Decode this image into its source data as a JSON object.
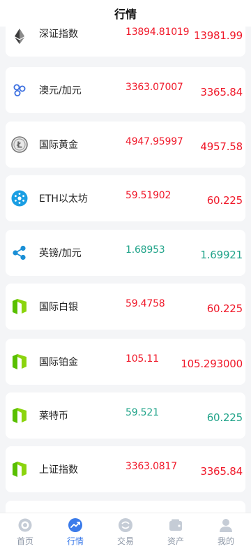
{
  "header": {
    "title": "行情"
  },
  "colors": {
    "up": "#f0192a",
    "down": "#22a48a",
    "active_tab": "#3b7bea",
    "inactive_tab": "#8f99a8"
  },
  "markets": [
    {
      "name": "深证指数",
      "price": "13894.81019",
      "change": "13981.99",
      "trend": "up",
      "icon": "ethereum-diamond-icon"
    },
    {
      "name": "澳元/加元",
      "price": "3363.07007",
      "change": "3365.84",
      "trend": "up",
      "icon": "chain-link-icon"
    },
    {
      "name": "国际黄金",
      "price": "4947.95997",
      "change": "4957.58",
      "trend": "up",
      "icon": "litecoin-icon"
    },
    {
      "name": "ETH以太坊",
      "price": "59.51902",
      "change": "60.225",
      "trend": "up",
      "icon": "cardano-icon"
    },
    {
      "name": "英镑/加元",
      "price": "1.68953",
      "change": "1.69921",
      "trend": "down",
      "icon": "ripple-icon"
    },
    {
      "name": "国际白银",
      "price": "59.4758",
      "change": "60.225",
      "trend": "up",
      "icon": "neo-icon"
    },
    {
      "name": "国际铂金",
      "price": "105.11",
      "change": "105.293000",
      "trend": "up",
      "icon": "neo-icon"
    },
    {
      "name": "莱特币",
      "price": "59.521",
      "change": "60.225",
      "trend": "down",
      "icon": "neo-icon"
    },
    {
      "name": "上证指数",
      "price": "3363.0817",
      "change": "3365.84",
      "trend": "up",
      "icon": "neo-icon"
    }
  ],
  "tabbar": [
    {
      "label": "首页",
      "icon": "home-icon",
      "active": false
    },
    {
      "label": "行情",
      "icon": "trend-chart-icon",
      "active": true
    },
    {
      "label": "交易",
      "icon": "exchange-icon",
      "active": false
    },
    {
      "label": "资产",
      "icon": "wallet-icon",
      "active": false
    },
    {
      "label": "我的",
      "icon": "user-icon",
      "active": false
    }
  ]
}
